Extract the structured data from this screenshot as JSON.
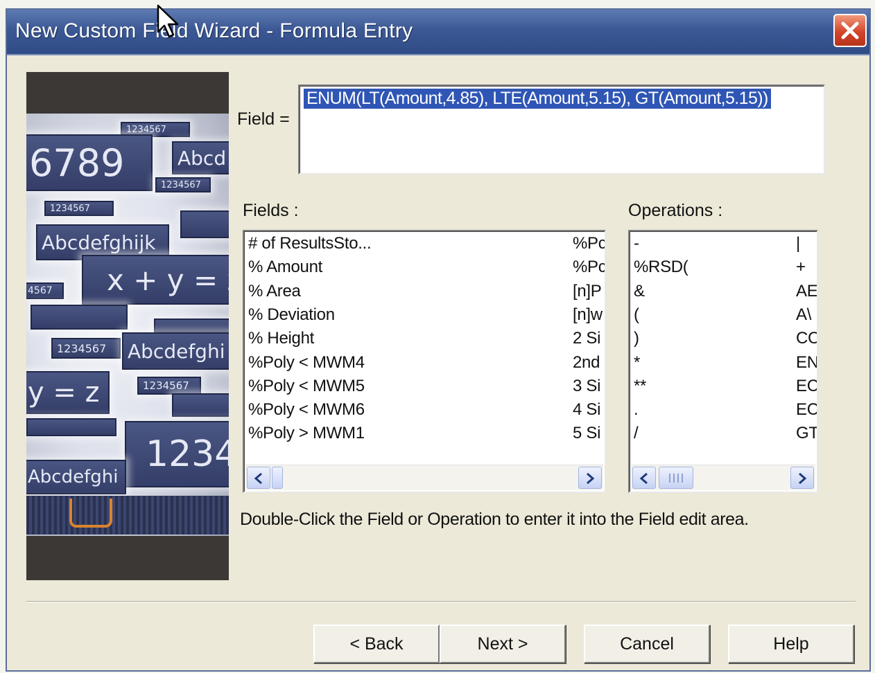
{
  "window": {
    "title": "New Custom Field Wizard - Formula Entry"
  },
  "side_image": {
    "texts": [
      "1234567",
      "6789",
      "Abcd",
      "1234567",
      "1234567",
      "Abcdefghijk",
      "x + y = z",
      "4567",
      "1234567",
      "Abcdefghi",
      "y = z",
      "1234567",
      "1234",
      "Abcdefghi"
    ]
  },
  "field": {
    "label": "Field =",
    "value": "ENUM(LT(Amount,4.85), LTE(Amount,5.15), GT(Amount,5.15))"
  },
  "fields_list": {
    "label": "Fields :",
    "items_col1": [
      "# of ResultsSto...",
      "% Amount",
      "% Area",
      "% Deviation",
      "% Height",
      "%Poly < MWM4",
      "%Poly < MWM5",
      "%Poly < MWM6",
      "%Poly > MWM1"
    ],
    "items_col2": [
      "%Pc",
      "%Pc",
      "[n]P",
      "[n]w",
      "2 Si",
      "2nd",
      "3 Si",
      "4 Si",
      "5 Si"
    ]
  },
  "operations_list": {
    "label": "Operations :",
    "items_col1": [
      "-",
      "%RSD(",
      "&",
      "(",
      ")",
      "*",
      "**",
      ".",
      "/"
    ],
    "items_col2": [
      "|",
      "+",
      "AE",
      "A\\",
      "CC",
      "EN",
      "EC",
      "EC",
      "GT"
    ]
  },
  "hint": "Double-Click the Field or Operation to enter it into the Field edit area.",
  "buttons": {
    "back": "< Back",
    "next": "Next >",
    "cancel": "Cancel",
    "help": "Help"
  },
  "colors": {
    "titlebar": "#3c5895",
    "selection": "#2f56b5",
    "dialog": "#ece9d8",
    "close": "#d3452a"
  }
}
